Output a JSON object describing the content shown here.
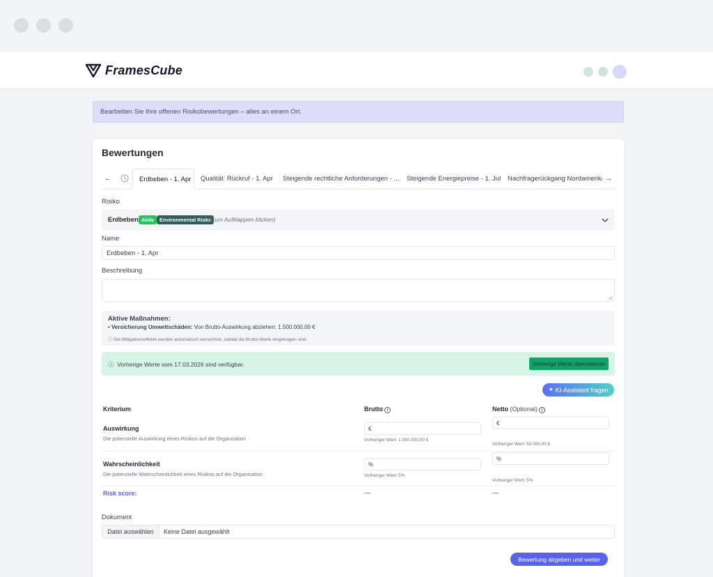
{
  "brand": {
    "name": "FramesCube"
  },
  "banner": {
    "text": "Bearbeiten Sie Ihre offenen Risikobewertungen – alles an einem Ort."
  },
  "card": {
    "title": "Bewertungen"
  },
  "tabs": [
    {
      "label": "Erdbeben - 1. Apr",
      "active": true
    },
    {
      "label": "Qualität: Rückruf - 1. Apr",
      "active": false
    },
    {
      "label": "Steigende rechtliche Anforderungen - ...",
      "active": false
    },
    {
      "label": "Steigende Energiepreise - 1. Jul",
      "active": false
    },
    {
      "label": "Nachfragerückgang Nordamerika",
      "active": false
    }
  ],
  "tab_nav": {
    "prev": "←",
    "next": "→"
  },
  "risk": {
    "label": "Risiko",
    "name": "Erdbeben",
    "status_badge": "Aktiv",
    "category_badge": "Environmental Risks",
    "hint": "(zum Aufklappen klicken)"
  },
  "name_field": {
    "label": "Name",
    "value": "Erdbeben -  1. Apr"
  },
  "description_field": {
    "label": "Beschreibung",
    "value": ""
  },
  "measures": {
    "title": "Aktive Maßnahmen:",
    "item_name": "Versicherung Umweltschäden:",
    "item_text": "Von Brutto-Auswirkung abziehen: 1.500.000,00 €",
    "note": "ⓘ Die Mitigationseffekte werden automatisch verrechnet, sobald die Brutto-Werte eingetragen sind."
  },
  "previous": {
    "text": "Vorherige Werte vom 17.03.2026 sind verfügbar.",
    "button": "Vorherige Werte übernehmen"
  },
  "ai_button": {
    "label": "KI-Assistent fragen"
  },
  "table": {
    "col_criterion": "Kriterium",
    "col_gross": "Brutto",
    "col_net": "Netto",
    "col_net_optional": "(Optional)",
    "rows": [
      {
        "title": "Auswirkung",
        "desc": "Die potenzielle Auswirkung eines Risikos auf die Organisation",
        "gross_unit": "€",
        "gross_prev": "Vorheriger Wert: 1.000.000,00 €",
        "net_unit": "€",
        "net_prev": "Vorheriger Wert: 50.000,00 €"
      },
      {
        "title": "Wahrscheinlichkeit",
        "desc": "Die potenzielle Wahrscheinlichkeit eines Risikos auf die Organisation",
        "gross_unit": "%",
        "gross_prev": "Vorheriger Wert: 5%",
        "net_unit": "%",
        "net_prev": "Vorheriger Wert: 5%"
      }
    ],
    "score_label": "Risk score:",
    "score_gross": "—",
    "score_net": "—"
  },
  "document": {
    "label": "Dokument",
    "button": "Datei auswählen",
    "status": "Keine Datei ausgewählt"
  },
  "submit": {
    "label": "Bewertung abgeben und weiter"
  },
  "colors": {
    "accent": "#5b63e8",
    "aktiv_badge": "#22c55e",
    "category_badge": "#2f5d5a",
    "success_bg": "#d7f5e6",
    "success_button": "#10a36a",
    "banner_bg": "#dcdefb",
    "risk_score_link": "#5b63e8"
  }
}
